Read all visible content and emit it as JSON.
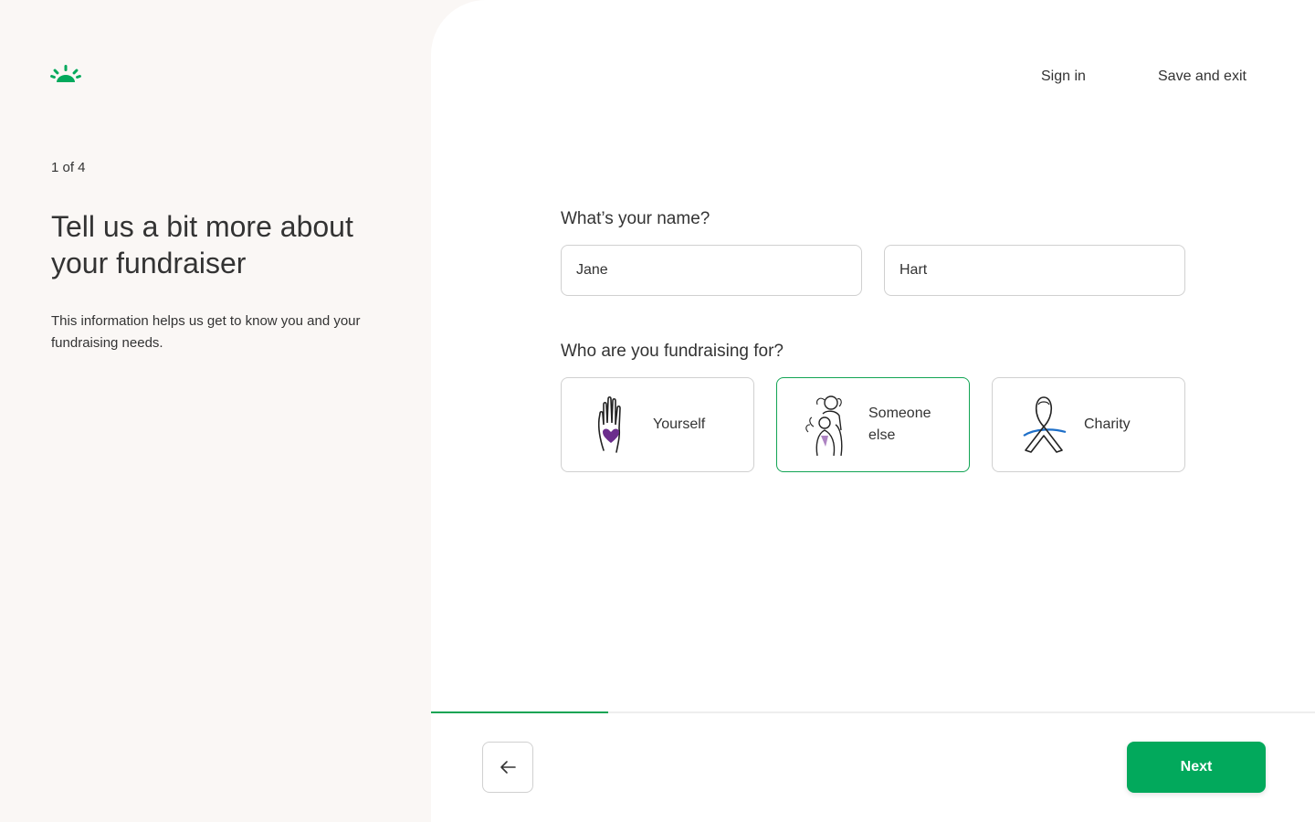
{
  "left": {
    "logo_icon": "sunrise-logo-icon",
    "step": "1 of 4",
    "heading": "Tell us a bit more about your fundraiser",
    "description": "This information helps us get to know you and your fundraising needs."
  },
  "header": {
    "sign_in": "Sign in",
    "save_exit": "Save and exit"
  },
  "form": {
    "name_question": "What’s your name?",
    "first_name": {
      "value": "Jane"
    },
    "last_name": {
      "value": "Hart"
    },
    "for_question": "Who are you fundraising for?",
    "options": [
      {
        "label": "Yourself",
        "icon": "hand-heart-icon",
        "selected": false
      },
      {
        "label": "Someone else",
        "icon": "people-hug-icon",
        "selected": true
      },
      {
        "label": "Charity",
        "icon": "ribbon-icon",
        "selected": false
      }
    ]
  },
  "progress": {
    "fraction": 0.2
  },
  "footer": {
    "back_icon": "arrow-left-icon",
    "next_label": "Next"
  },
  "colors": {
    "accent": "#02a95c",
    "left_background": "#faf7f5",
    "heart_purple": "#6b2d8c",
    "ribbon_blue": "#1e6fc8"
  }
}
